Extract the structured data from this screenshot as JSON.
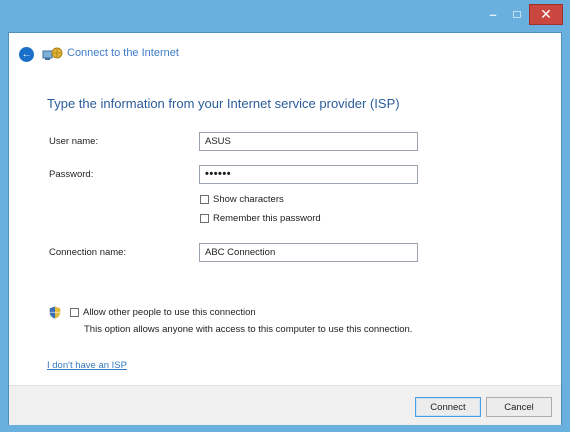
{
  "window": {
    "title": "",
    "caption_buttons": {
      "minimize": "–",
      "close": "✕"
    }
  },
  "nav": {
    "title": "Connect to the Internet",
    "back_glyph": "←"
  },
  "form": {
    "heading": "Type the information from your Internet service provider (ISP)",
    "username_label": "User name:",
    "username_value": "ASUS",
    "password_label": "Password:",
    "password_value": "••••••",
    "show_characters_label": "Show characters",
    "show_characters_checked": false,
    "remember_password_label": "Remember this password",
    "remember_password_checked": false,
    "connection_name_label": "Connection name:",
    "connection_name_value": "ABC Connection"
  },
  "sharing": {
    "allow_label": "Allow other people to use this connection",
    "allow_checked": false,
    "description": "This option allows anyone with access to this computer to use this connection."
  },
  "link": {
    "no_isp": "I don't have an ISP"
  },
  "buttons": {
    "connect": "Connect",
    "cancel": "Cancel"
  },
  "colors": {
    "window_frame": "#6ab0df",
    "close_button": "#c9473f",
    "heading_text": "#2a5c9a",
    "link_text": "#3478c0"
  },
  "icons": {
    "back": "back-arrow-icon",
    "wizard": "network-connection-icon",
    "shield": "uac-shield-icon"
  }
}
